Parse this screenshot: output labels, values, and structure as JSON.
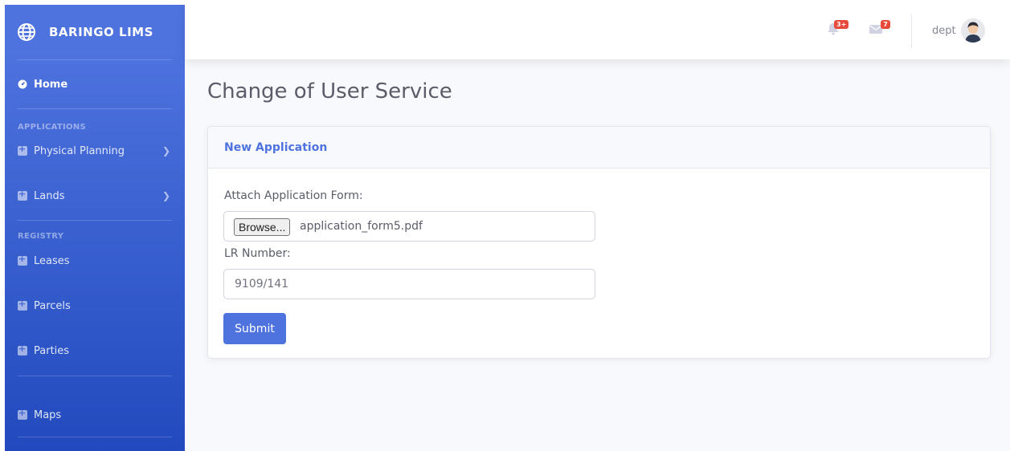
{
  "sidebar": {
    "brand": "BARINGO LIMS",
    "home": "Home",
    "heading_applications": "APPLICATIONS",
    "heading_registry": "REGISTRY",
    "items": [
      {
        "label": "Physical Planning"
      },
      {
        "label": "Lands"
      },
      {
        "label": "Leases"
      },
      {
        "label": "Parcels"
      },
      {
        "label": "Parties"
      },
      {
        "label": "Maps"
      }
    ]
  },
  "topbar": {
    "alerts_badge": "3+",
    "messages_badge": "7",
    "username": "dept",
    "icons": [
      "bell-icon",
      "envelope-icon",
      "avatar"
    ]
  },
  "page": {
    "title": "Change of User Service"
  },
  "form": {
    "header": "New Application",
    "attach_label": "Attach Application Form:",
    "browse_label": "Browse...",
    "file_name": "application_form5.pdf",
    "lr_label": "LR Number:",
    "lr_value": "9109/141",
    "submit_label": "Submit"
  },
  "colors": {
    "primary": "#4e73df",
    "sidebar_dark": "#224abe",
    "badge": "#e74a3b",
    "text": "#5a5c69",
    "background": "#f8f9fc"
  }
}
